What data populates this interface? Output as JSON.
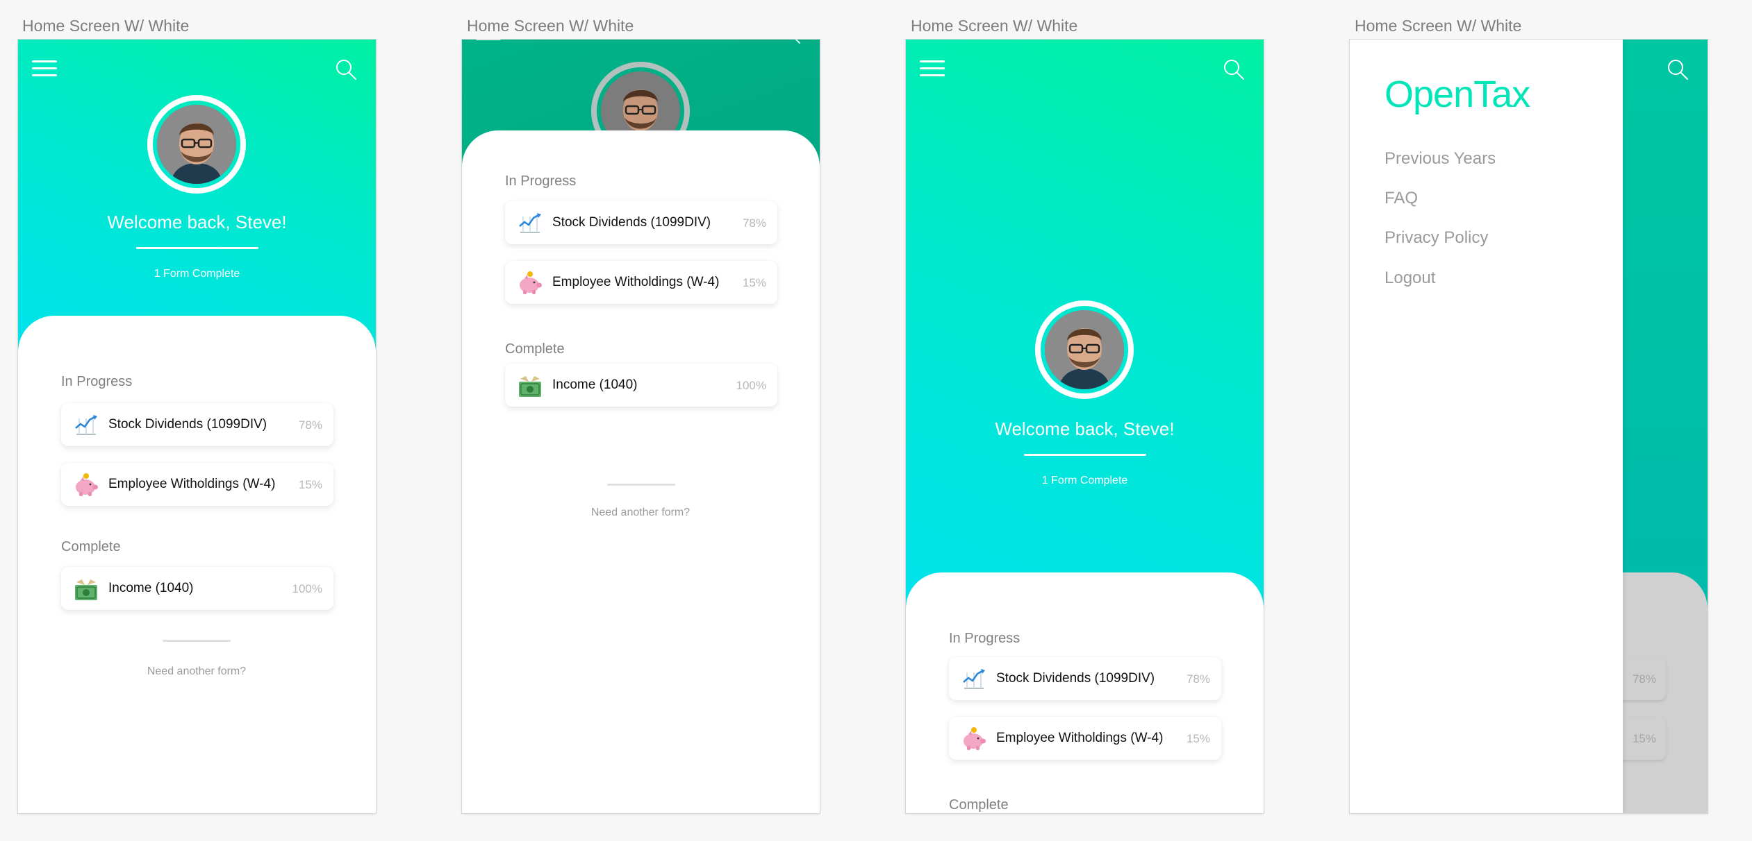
{
  "artboard_label": "Home Screen W/ White",
  "colors": {
    "gradient_start": "#00f0a2",
    "gradient_end": "#00e2f0",
    "brand": "#00e6b8",
    "muted_text": "#808080"
  },
  "icons": {
    "menu": "hamburger-icon",
    "search": "search-icon",
    "stock": "chart-increasing-emoji",
    "withholding": "piggy-bank-emoji",
    "income": "money-with-wings-emoji"
  },
  "home": {
    "welcome": "Welcome back, Steve!",
    "forms_complete": "1 Form Complete",
    "in_progress_title": "In Progress",
    "complete_title": "Complete",
    "need_another": "Need another form?",
    "in_progress": [
      {
        "title": "Stock Dividends (1099DIV)",
        "percent": "78%",
        "icon": "chart-increasing-emoji"
      },
      {
        "title": "Employee Witholdings (W-4)",
        "percent": "15%",
        "icon": "piggy-bank-emoji"
      }
    ],
    "complete": [
      {
        "title": "Income (1040)",
        "percent": "100%",
        "icon": "money-with-wings-emoji"
      }
    ]
  },
  "drawer": {
    "brand": "OpenTax",
    "items": [
      "Previous Years",
      "FAQ",
      "Privacy Policy",
      "Logout"
    ]
  }
}
